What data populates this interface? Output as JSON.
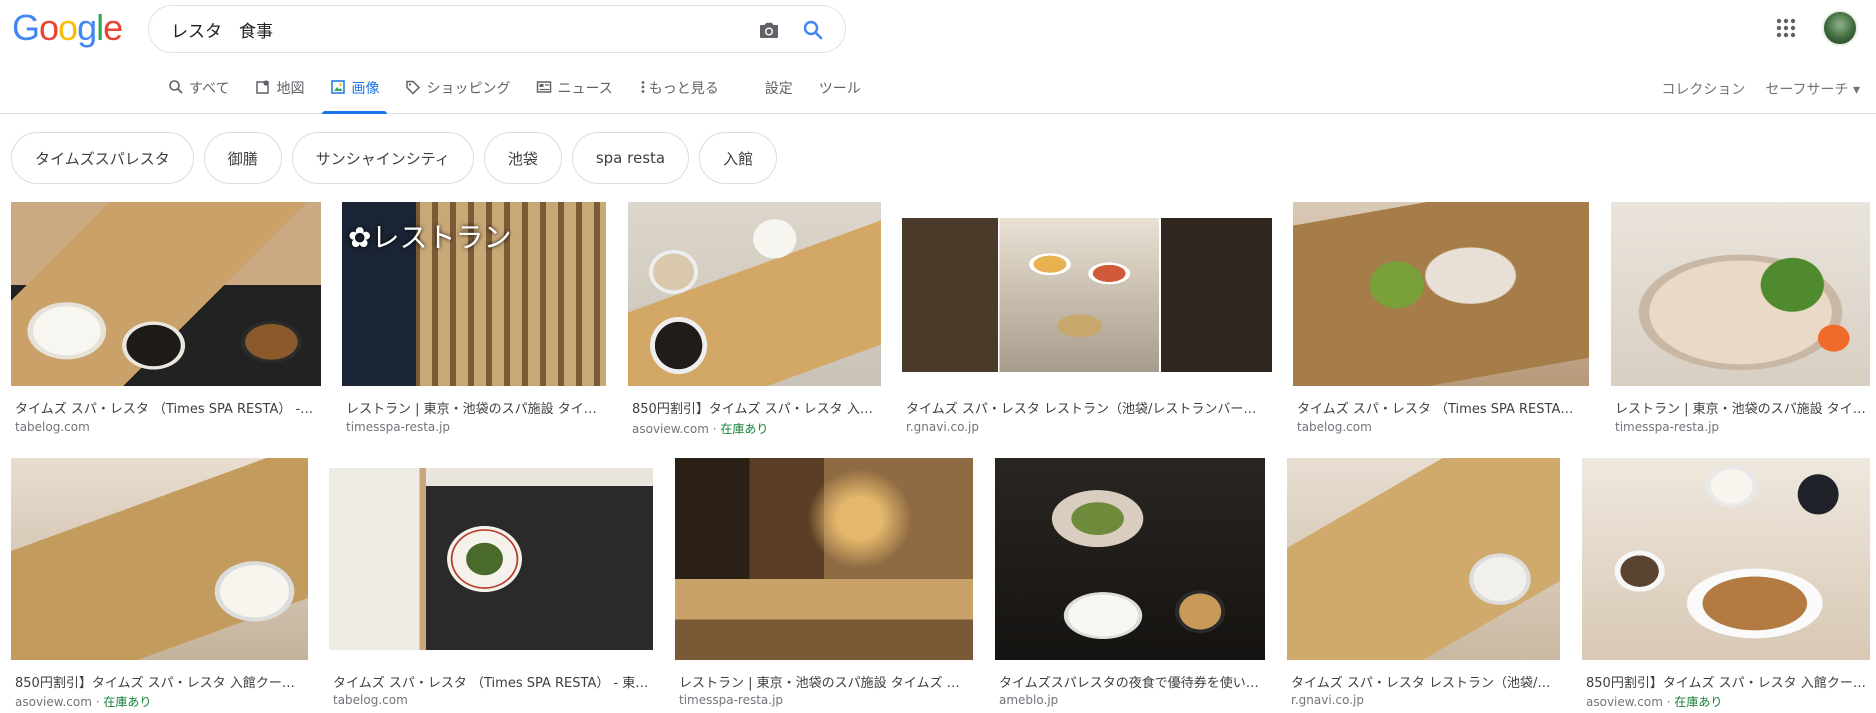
{
  "logo": {
    "letters": [
      "G",
      "o",
      "o",
      "g",
      "l",
      "e"
    ],
    "colors": [
      "#4285f4",
      "#ea4335",
      "#fbbc05",
      "#4285f4",
      "#34a853",
      "#ea4335"
    ]
  },
  "search": {
    "value": "レスタ　食事",
    "icons": [
      "camera-icon",
      "search-icon"
    ]
  },
  "header_icons": [
    "apps-grid-icon",
    "avatar"
  ],
  "tabs": [
    {
      "label": "すべて",
      "icon": "search-icon"
    },
    {
      "label": "地図",
      "icon": "map-icon"
    },
    {
      "label": "画像",
      "icon": "image-icon",
      "active": true
    },
    {
      "label": "ショッピング",
      "icon": "tag-icon"
    },
    {
      "label": "ニュース",
      "icon": "news-icon"
    },
    {
      "label": "もっと見る",
      "icon": "more-vert-icon"
    },
    {
      "label": "設定"
    },
    {
      "label": "ツール"
    }
  ],
  "right_links": {
    "collection": "コレクション",
    "safesearch": "セーフサーチ ▾"
  },
  "chips": [
    "タイムズスパレスタ",
    "御膳",
    "サンシャインシティ",
    "池袋",
    "spa resta",
    "入館"
  ],
  "results": [
    {
      "caption": "タイムズ スパ・レスタ （Times SPA RESTA） - …",
      "source": "tabelog.com"
    },
    {
      "caption": "レストラン | 東京・池袋のスパ施設 タイ…",
      "source": "timesspa-resta.jp"
    },
    {
      "caption": "850円割引】タイムズ スパ・レスタ 入…",
      "source": "asoview.com",
      "stock": "在庫あり"
    },
    {
      "caption": "タイムズ スパ・レスタ レストラン（池袋/レストランバー…",
      "source": "r.gnavi.co.jp"
    },
    {
      "caption": "タイムズ スパ・レスタ （Times SPA RESTA） …",
      "source": "tabelog.com"
    },
    {
      "caption": "レストラン | 東京・池袋のスパ施設 タイ…",
      "source": "timesspa-resta.jp"
    },
    {
      "caption": "850円割引】タイムズ スパ・レスタ 入館クー…",
      "source": "asoview.com",
      "stock": "在庫あり"
    },
    {
      "caption": "タイムズ スパ・レスタ （Times SPA RESTA） - 東…",
      "source": "tabelog.com"
    },
    {
      "caption": "レストラン | 東京・池袋のスパ施設 タイムズ …",
      "source": "timesspa-resta.jp"
    },
    {
      "caption": "タイムズスパレスタの夜食で優待券を使い…",
      "source": "ameblo.jp"
    },
    {
      "caption": "タイムズ スパ・レスタ レストラン（池袋/…",
      "source": "r.gnavi.co.jp"
    },
    {
      "caption": "850円割引】タイムズ スパ・レスタ 入館クー…",
      "source": "asoview.com",
      "stock": "在庫あり"
    }
  ],
  "thumb_overlay": {
    "restaurant_label": "レストラン"
  }
}
